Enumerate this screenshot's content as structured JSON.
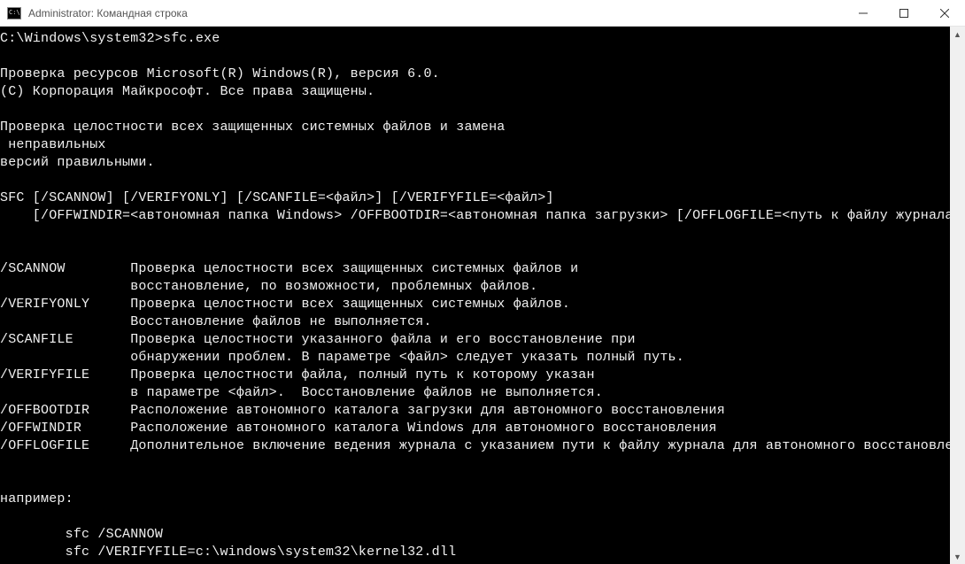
{
  "window": {
    "title": "Administrator: Командная строка"
  },
  "terminal": {
    "prompt_line": "C:\\Windows\\system32>sfc.exe",
    "lines": [
      "",
      "Проверка ресурсов Microsoft(R) Windows(R), версия 6.0.",
      "(C) Корпорация Майкрософт. Все права защищены.",
      "",
      "Проверка целостности всех защищенных системных файлов и замена",
      " неправильных",
      "версий правильными.",
      "",
      "SFC [/SCANNOW] [/VERIFYONLY] [/SCANFILE=<файл>] [/VERIFYFILE=<файл>]",
      "    [/OFFWINDIR=<автономная папка Windows> /OFFBOOTDIR=<автономная папка загрузки> [/OFFLOGFILE=<путь к файлу журнала>]]",
      "",
      "",
      "/SCANNOW        Проверка целостности всех защищенных системных файлов и",
      "                восстановление, по возможности, проблемных файлов.",
      "/VERIFYONLY     Проверка целостности всех защищенных системных файлов.",
      "                Восстановление файлов не выполняется.",
      "/SCANFILE       Проверка целостности указанного файла и его восстановление при",
      "                обнаружении проблем. В параметре <файл> следует указать полный путь.",
      "/VERIFYFILE     Проверка целостности файла, полный путь к которому указан",
      "                в параметре <файл>.  Восстановление файлов не выполняется.",
      "/OFFBOOTDIR     Расположение автономного каталога загрузки для автономного восстановления",
      "/OFFWINDIR      Расположение автономного каталога Windows для автономного восстановления",
      "/OFFLOGFILE     Дополнительное включение ведения журнала с указанием пути к файлу журнала для автономного восстановления",
      "",
      "",
      "например:",
      "",
      "        sfc /SCANNOW",
      "        sfc /VERIFYFILE=c:\\windows\\system32\\kernel32.dll"
    ]
  }
}
